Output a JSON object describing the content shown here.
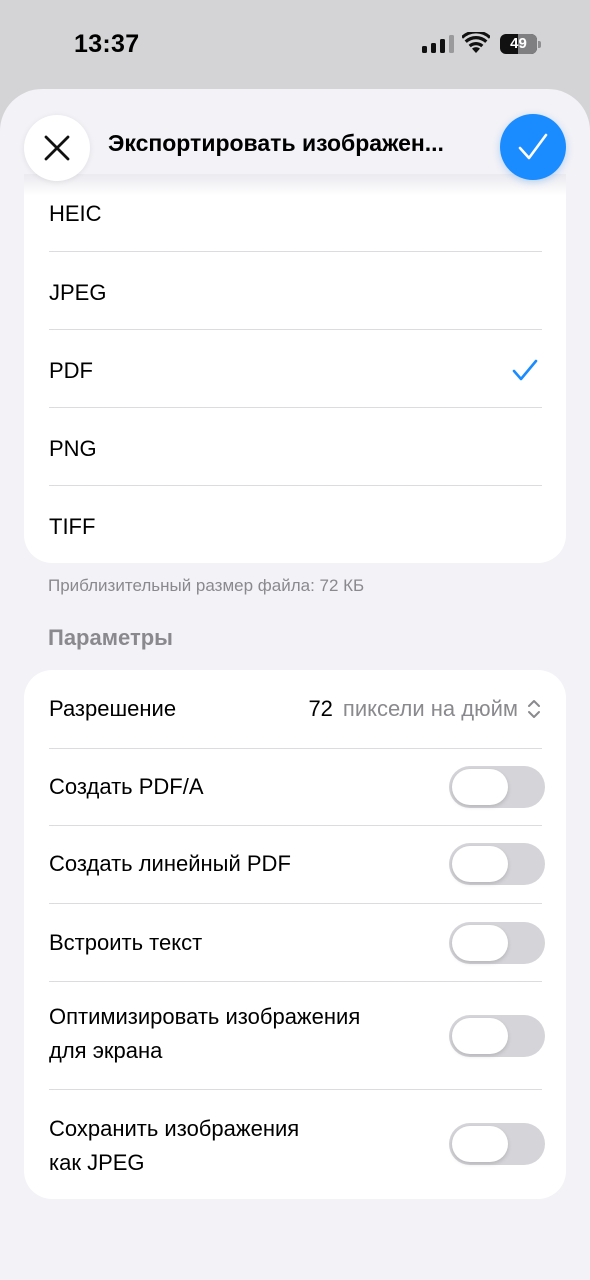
{
  "status_bar": {
    "time": "13:37",
    "signal_bars": 4,
    "signal_bars_filled": 3,
    "wifi": "wifi-icon",
    "battery_level": "49",
    "battery_fraction": 0.49
  },
  "sheet": {
    "title": "Экспортировать изображен...",
    "close_icon": "close-icon",
    "confirm_icon": "checkmark-icon",
    "accent_color": "#1a8cff"
  },
  "formats": {
    "items": [
      {
        "label": "HEIC",
        "selected": false
      },
      {
        "label": "JPEG",
        "selected": false
      },
      {
        "label": "PDF",
        "selected": true
      },
      {
        "label": "PNG",
        "selected": false
      },
      {
        "label": "TIFF",
        "selected": false
      }
    ],
    "file_size_hint": "Приблизительный размер файла: 72 КБ"
  },
  "parameters": {
    "header": "Параметры",
    "resolution": {
      "label": "Разрешение",
      "value": "72",
      "unit": "пиксели на дюйм"
    },
    "toggles": [
      {
        "label": "Создать PDF/A",
        "on": false
      },
      {
        "label": "Создать линейный PDF",
        "on": false
      },
      {
        "label": "Встроить текст",
        "on": false
      },
      {
        "label": "Оптимизировать изображения для экрана",
        "line1": "Оптимизировать изображения",
        "line2": "для экрана",
        "on": false
      },
      {
        "label": "Сохранить изображения как JPEG",
        "line1": "Сохранить изображения",
        "line2": "как JPEG",
        "on": false
      }
    ]
  }
}
